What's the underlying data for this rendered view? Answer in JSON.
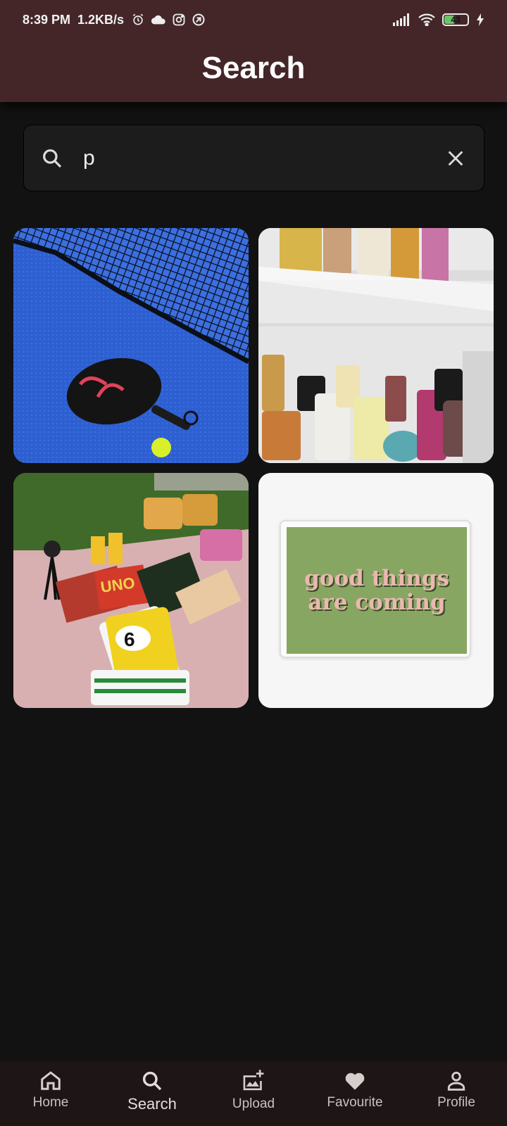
{
  "status_bar": {
    "time": "8:39 PM",
    "network_speed": "1.2KB/s",
    "left_icons": [
      "alarm-icon",
      "cloud-icon",
      "instagram-icon",
      "vpn-icon"
    ],
    "right_icons": [
      "signal-icon",
      "wifi-icon",
      "battery-icon",
      "charging-icon"
    ],
    "battery_percent": "43",
    "battery_level": 0.43
  },
  "header": {
    "title": "Search"
  },
  "search": {
    "value": "p",
    "icon": "search-icon",
    "clear_icon": "close-icon"
  },
  "results": [
    {
      "subject": "padel racket and ball on blue court"
    },
    {
      "subject": "perfume bottles on white shelves"
    },
    {
      "subject": "picnic with games and snacks"
    },
    {
      "subject": "poster",
      "poster_line1": "good things",
      "poster_line2": "are coming"
    }
  ],
  "nav": {
    "items": [
      {
        "label": "Home",
        "icon": "home-icon",
        "active": false
      },
      {
        "label": "Search",
        "icon": "search-icon",
        "active": true
      },
      {
        "label": "Upload",
        "icon": "add-photo-icon",
        "active": false
      },
      {
        "label": "Favourite",
        "icon": "heart-icon",
        "active": false
      },
      {
        "label": "Profile",
        "icon": "person-icon",
        "active": false
      }
    ]
  },
  "colors": {
    "header_bg": "#442629",
    "page_bg": "#121212",
    "search_bg": "#1c1c1c",
    "nav_bg": "#1e1516",
    "poster_green": "#86a662",
    "poster_text": "#eab8b0"
  }
}
